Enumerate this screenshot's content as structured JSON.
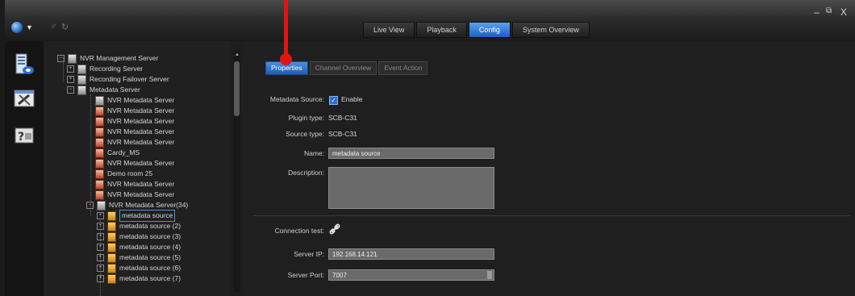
{
  "top_tabs": [
    "Live View",
    "Playback",
    "Config",
    "System Overview"
  ],
  "active_top_tab": "Config",
  "window_controls": {
    "minimize": "–",
    "restore": "ᵟ",
    "close": "X"
  },
  "tree": {
    "root": "NVR Management Server",
    "items": [
      "Recording Server",
      "Recording Failover Server",
      "Metadata Server",
      "NVR Metadata Server",
      "NVR Metadata Server",
      "NVR Metadata Server",
      "NVR Metadata Server",
      "NVR Metadata Server",
      "Cardy_MS",
      "NVR Metadata Server",
      "Demo room 25",
      "NVR Metadata Server",
      "NVR Metadata Server",
      "NVR Metadata Server(34)",
      "metadata source",
      "metadata source (2)",
      "metadata source (3)",
      "metadata source (4)",
      "metadata source (5)",
      "metadata source (6)",
      "metadata source (7)"
    ]
  },
  "sub_tabs": [
    "Properties",
    "Channel Overview",
    "Event Action"
  ],
  "form": {
    "metadata_source_label": "Metadata Source:",
    "enable_label": "Enable",
    "plugin_type_label": "Plugin type:",
    "plugin_type_value": "SCB-C31",
    "source_type_label": "Source type:",
    "source_type_value": "SCB-C31",
    "name_label": "Name:",
    "name_value": "metadata source",
    "description_label": "Description:",
    "description_value": "",
    "connection_test_label": "Connection test:",
    "server_ip_label": "Server IP:",
    "server_ip_value": "192.168.14.121",
    "server_port_label": "Server Port:",
    "server_port_value": "7007"
  },
  "annotation_color": "#e01414"
}
